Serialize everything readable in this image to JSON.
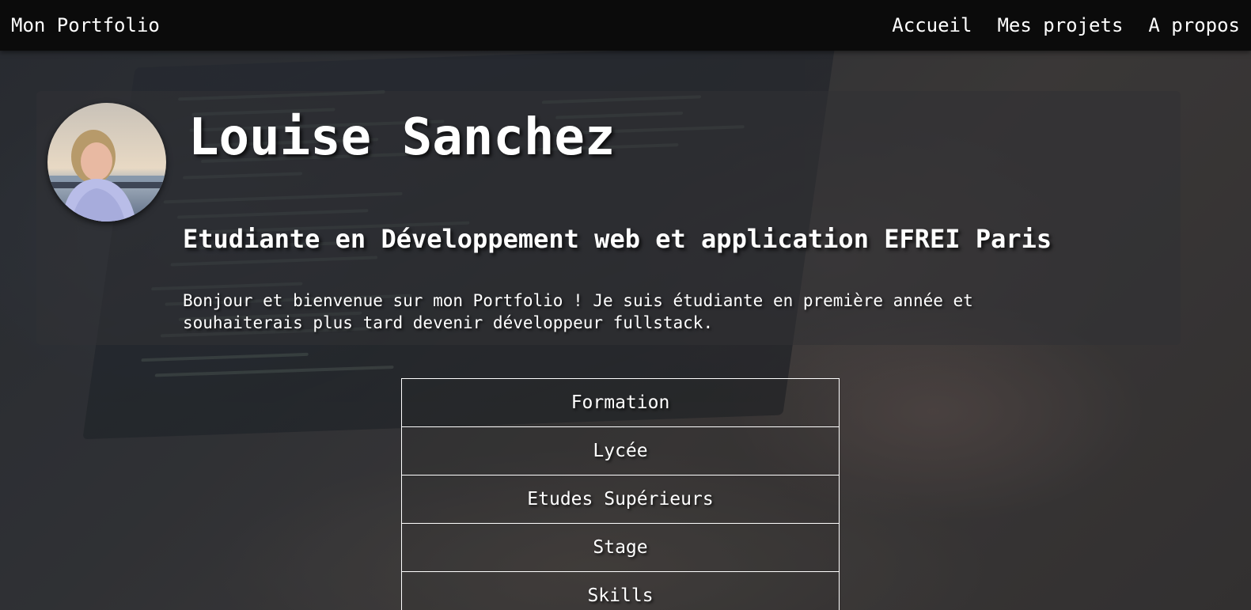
{
  "navbar": {
    "brand": "Mon Portfolio",
    "links": [
      "Accueil",
      "Mes projets",
      "A propos"
    ]
  },
  "hero": {
    "name": "Louise Sanchez",
    "subtitle": "Etudiante en Développement web et application EFREI Paris",
    "intro": "Bonjour et bienvenue sur mon Portfolio ! Je suis étudiante en première année et souhaiterais plus tard devenir développeur fullstack."
  },
  "menu": {
    "items": [
      "Formation",
      "Lycée",
      "Etudes Supérieurs",
      "Stage",
      "Skills"
    ]
  },
  "colors": {
    "navbar_bg": "#0b0b0b",
    "text": "#ffffff",
    "menu_border": "#ffffff"
  },
  "icons": {
    "avatar": "profile-photo"
  }
}
